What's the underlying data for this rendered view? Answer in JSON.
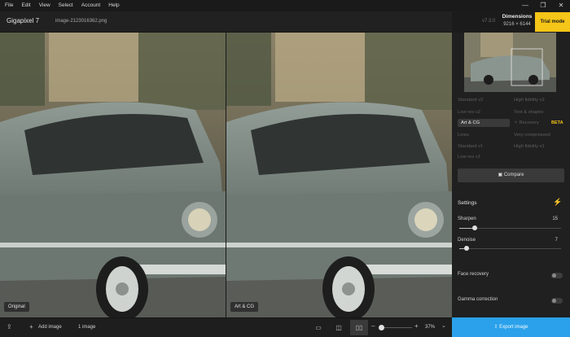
{
  "menu": [
    "File",
    "Edit",
    "View",
    "Select",
    "Account",
    "Help"
  ],
  "window_controls": {
    "minimize": "—",
    "restore": "❐",
    "close": "✕"
  },
  "app": {
    "name": "Gigapixel 7",
    "filename": "image-2123016362.png",
    "version": "v7.3.0"
  },
  "dimensions": {
    "label": "Dimensions",
    "value": "9216 × 6144"
  },
  "trial_label": "Trial mode",
  "panes": {
    "left_label": "Original",
    "right_label": "Art & CG"
  },
  "models": [
    "Standard v2",
    "High fidelity v2",
    "Low res v2",
    "Text & shapes",
    "Art & CG",
    "Recovery",
    "Lines",
    "Very compressed",
    "Standard v1",
    "High fidelity v1",
    "Low res v1"
  ],
  "beta_label": "BETA",
  "compare_label": "Compare",
  "settings": {
    "title": "Settings",
    "sharpen": {
      "label": "Sharpen",
      "value": "15",
      "fraction": 0.15
    },
    "denoise": {
      "label": "Denoise",
      "value": "7",
      "fraction": 0.07
    },
    "face_recovery": {
      "label": "Face recovery",
      "on": false
    },
    "gamma_correction": {
      "label": "Gamma correction",
      "on": false
    }
  },
  "bottom": {
    "add_image_label": "Add image",
    "image_count": "1 image",
    "zoom": "37%"
  },
  "export_label": "Export image",
  "colors": {
    "accent": "#2aa1ea",
    "trial": "#f5c518"
  }
}
